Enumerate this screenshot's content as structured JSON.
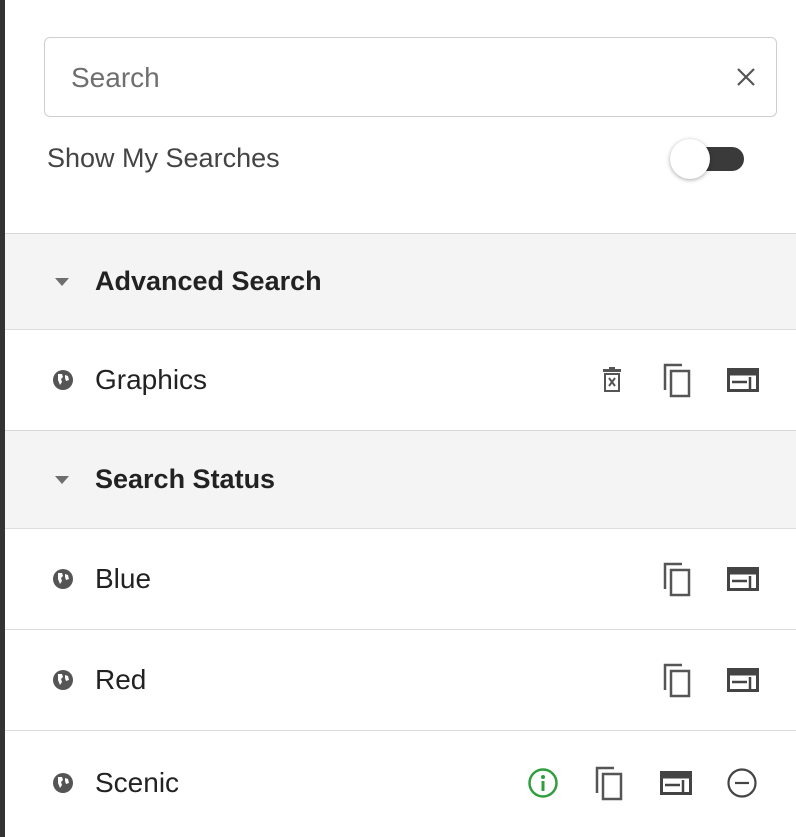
{
  "search": {
    "placeholder": "Search",
    "value": "",
    "clear_icon": "close-icon"
  },
  "toggle": {
    "label": "Show My Searches",
    "on": false
  },
  "groups": [
    {
      "label": "Advanced Search",
      "expanded": true,
      "items": [
        {
          "label": "Graphics",
          "icon": "globe-icon",
          "actions": [
            "delete-icon",
            "copy-icon",
            "details-icon"
          ]
        }
      ]
    },
    {
      "label": "Search Status",
      "expanded": true,
      "items": [
        {
          "label": "Blue",
          "icon": "globe-icon",
          "actions": [
            "copy-icon",
            "details-icon"
          ]
        },
        {
          "label": "Red",
          "icon": "globe-icon",
          "actions": [
            "copy-icon",
            "details-icon"
          ]
        },
        {
          "label": "Scenic",
          "icon": "globe-icon",
          "actions": [
            "info-icon",
            "copy-icon",
            "details-icon",
            "remove-icon"
          ]
        }
      ]
    }
  ],
  "colors": {
    "info": "#2e9e3e",
    "icon": "#444444",
    "header_bg": "#f4f4f4"
  }
}
